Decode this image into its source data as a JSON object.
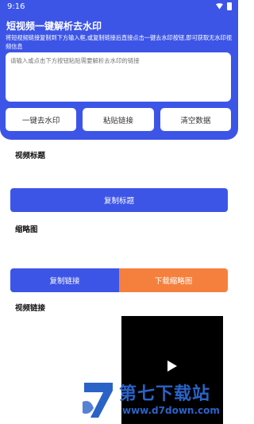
{
  "status": {
    "time": "9:16"
  },
  "header": {
    "title": "短视频一键解析去水印",
    "description": "将短视频链接复制到下方输入框,或复制链接后直接点击一键去水印按钮,即可获取无水印视频信息"
  },
  "input": {
    "placeholder": "请输入或点击下方按钮粘贴需要解析去水印的链接",
    "value": ""
  },
  "buttons": {
    "remove_watermark": "一键去水印",
    "paste_link": "粘贴链接",
    "clear_data": "清空数据",
    "copy_title": "复制标题",
    "copy_link": "复制链接",
    "download_thumbnail": "下载缩略图"
  },
  "sections": {
    "video_title": "视频标题",
    "thumbnail": "缩略图",
    "video_link": "视频链接"
  },
  "watermark": {
    "name": "第七下载站",
    "url": "www.d7down.com"
  },
  "colors": {
    "primary": "#3d55e6",
    "accent": "#f5803d",
    "watermark": "#2a63c8"
  }
}
